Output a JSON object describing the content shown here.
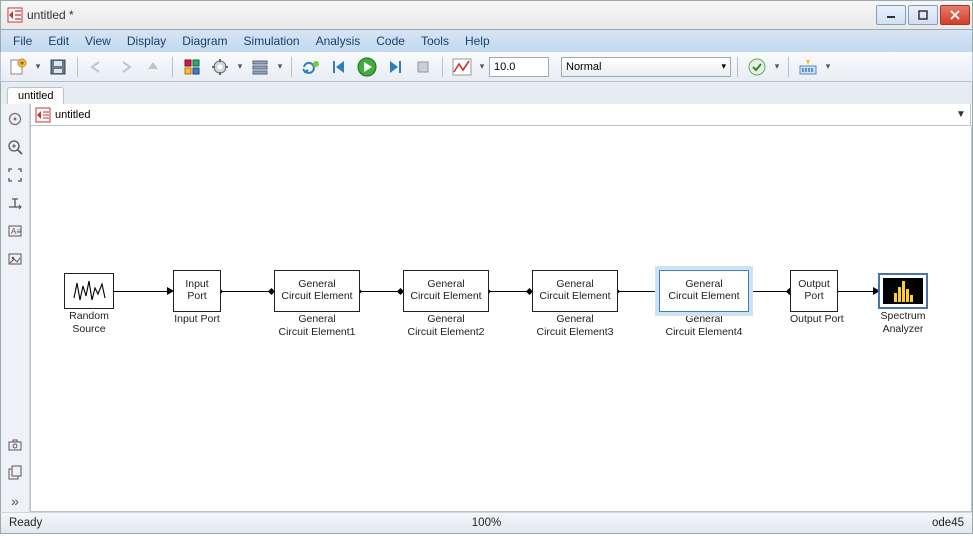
{
  "window": {
    "title": "untitled *"
  },
  "menu": [
    "File",
    "Edit",
    "View",
    "Display",
    "Diagram",
    "Simulation",
    "Analysis",
    "Code",
    "Tools",
    "Help"
  ],
  "toolbar": {
    "time_value": "10.0",
    "mode": "Normal"
  },
  "tab": {
    "label": "untitled"
  },
  "breadcrumb": {
    "model": "untitled"
  },
  "blocks": {
    "random": {
      "line1": "Random",
      "line2": "Source"
    },
    "inport": {
      "box1": "Input",
      "box2": "Port",
      "label": "Input Port"
    },
    "gce1": {
      "box1": "General",
      "box2": "Circuit Element",
      "label1": "General",
      "label2": "Circuit Element1"
    },
    "gce2": {
      "box1": "General",
      "box2": "Circuit Element",
      "label1": "General",
      "label2": "Circuit Element2"
    },
    "gce3": {
      "box1": "General",
      "box2": "Circuit Element",
      "label1": "General",
      "label2": "Circuit Element3"
    },
    "gce4": {
      "box1": "General",
      "box2": "Circuit Element",
      "label1": "General",
      "label2": "Circuit Element4"
    },
    "outport": {
      "box1": "Output",
      "box2": "Port",
      "label": "Output Port"
    },
    "scope": {
      "line1": "Spectrum",
      "line2": "Analyzer"
    }
  },
  "status": {
    "left": "Ready",
    "center": "100%",
    "right": "ode45"
  }
}
